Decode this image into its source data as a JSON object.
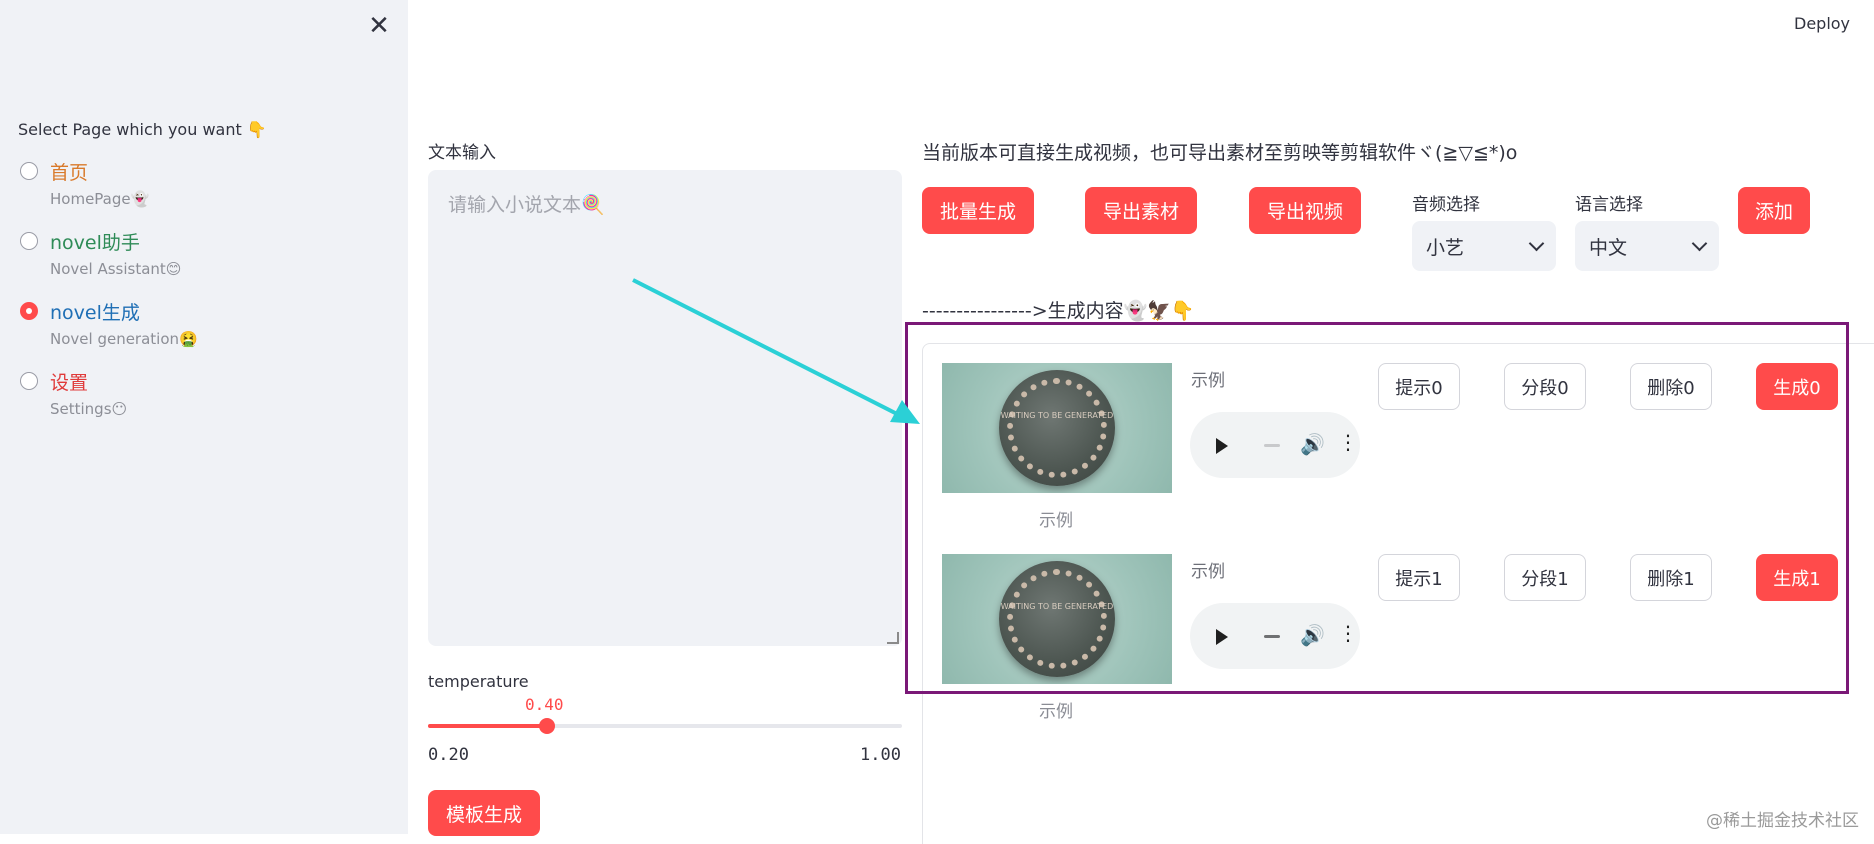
{
  "app": {
    "deploy_label": "Deploy"
  },
  "sidebar": {
    "close_label": "✕",
    "select_label": "Select Page which you want 👇",
    "items": [
      {
        "title": "首页",
        "subtitle": "HomePage👻",
        "title_color": "#d97a2b",
        "selected": false
      },
      {
        "title": "novel助手",
        "subtitle": "Novel Assistant😊",
        "title_color": "#2e8b57",
        "selected": false
      },
      {
        "title": "novel生成",
        "subtitle": "Novel generation🤮",
        "title_color": "#1f6fb5",
        "selected": true
      },
      {
        "title": "设置",
        "subtitle": "Settings😶",
        "title_color": "#e03a3a",
        "selected": false
      }
    ]
  },
  "left": {
    "text_label": "文本输入",
    "text_placeholder": "请输入小说文本🍭",
    "slider_label": "temperature",
    "slider_value": "0.40",
    "slider_min": "0.20",
    "slider_max": "1.00",
    "slider_fraction": 0.25,
    "template_button": "模板生成"
  },
  "right": {
    "info": "当前版本可直接生成视频，也可导出素材至剪映等剪辑软件ヾ(≧▽≦*)o",
    "buttons": {
      "batch": "批量生成",
      "export_material": "导出素材",
      "export_video": "导出视频",
      "add": "添加"
    },
    "audio_select": {
      "label": "音频选择",
      "value": "小艺"
    },
    "language_select": {
      "label": "语言选择",
      "value": "中文"
    },
    "gen_header": "---------------->生成内容👻🦅👇",
    "rows": [
      {
        "caption": "示例",
        "audio_label": "示例",
        "image_text": "WAITING TO BE GENERATED",
        "prompt": "提示0",
        "segment": "分段0",
        "delete": "删除0",
        "generate": "生成0"
      },
      {
        "caption": "示例",
        "audio_label": "示例",
        "image_text": "WAITING TO BE GENERATED",
        "prompt": "提示1",
        "segment": "分段1",
        "delete": "删除1",
        "generate": "生成1"
      }
    ]
  },
  "colors": {
    "primary": "#ff4b4b",
    "highlight_box": "#7a1877",
    "arrow": "#2bd0d6"
  },
  "watermark": "@稀土掘金技术社区"
}
